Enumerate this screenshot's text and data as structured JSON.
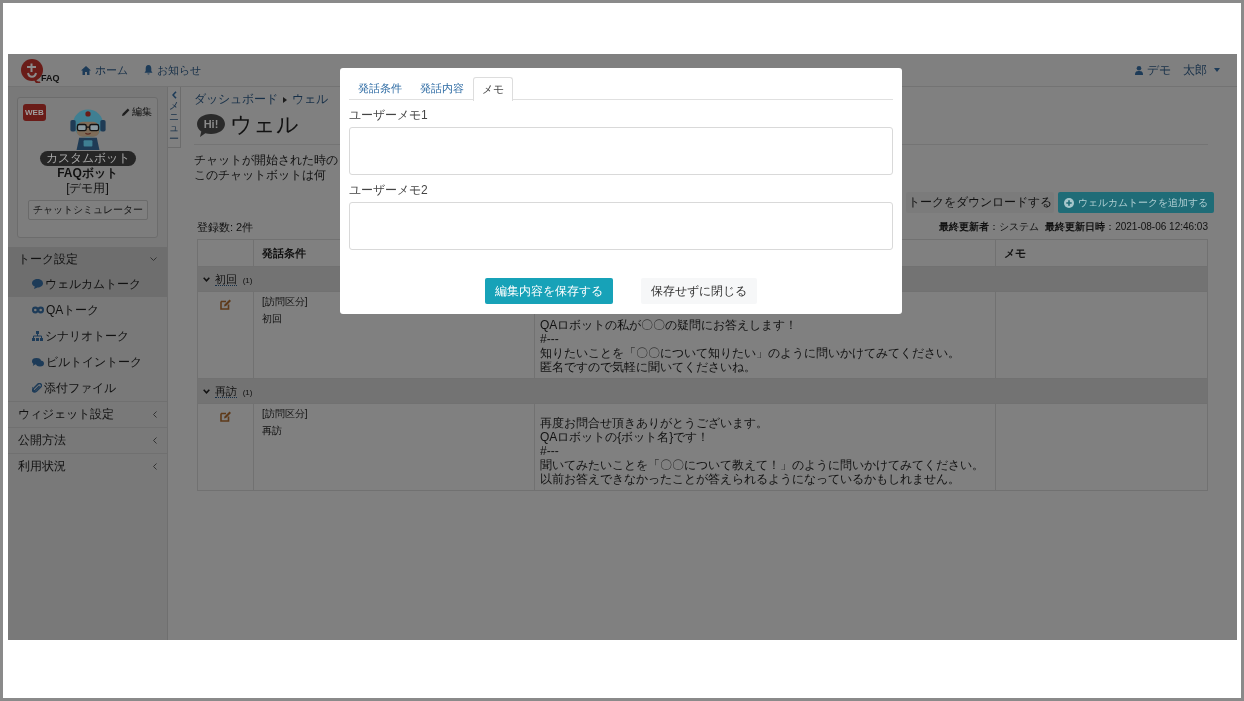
{
  "header": {
    "logo_text": "FAQ",
    "nav": [
      {
        "label": "ホーム"
      },
      {
        "label": "お知らせ"
      }
    ],
    "user": "デモ　太郎"
  },
  "sidebar": {
    "profile": {
      "web_badge": "WEB",
      "edit": "編集",
      "badge": "カスタムボット",
      "name": "FAQボット",
      "note": "[デモ用]",
      "simulator_button": "チャットシミュレーター"
    },
    "menu": [
      {
        "label": "トーク設定",
        "expanded": true,
        "children": [
          {
            "label": "ウェルカムトーク",
            "selected": true
          },
          {
            "label": "QAトーク",
            "selected": false
          },
          {
            "label": "シナリオトーク",
            "selected": false
          },
          {
            "label": "ビルトイントーク",
            "selected": false
          },
          {
            "label": "添付ファイル",
            "selected": false
          }
        ]
      },
      {
        "label": "ウィジェット設定",
        "expanded": false
      },
      {
        "label": "公開方法",
        "expanded": false
      },
      {
        "label": "利用状況",
        "expanded": false
      }
    ]
  },
  "main": {
    "menu_toggle": "メニュー",
    "breadcrumb": [
      "ダッシュボード",
      "ウェル"
    ],
    "title_icon": "Hi!",
    "title": "ウェル",
    "description": [
      "チャットが開始された時の",
      "このチャットボットは何"
    ],
    "actions": [
      {
        "label": "トークをダウンロードする",
        "kind": "secondary"
      },
      {
        "label": "ウェルカムトークを追加する",
        "kind": "primary"
      }
    ],
    "count": "登録数: 2件",
    "updated_by": "**最終更新者**：システム",
    "updated_at": "**最終更新日時**：2021-08-06 12:46:03",
    "table": {
      "header": {
        "condition": "発話条件",
        "memo": "メモ"
      },
      "groups": [
        {
          "label": "初回",
          "count": "(1)",
          "expanded": true,
          "rows": [
            {
              "condition_label": "[訪問区分]",
              "condition_value": "初回",
              "content": [
                "QAロボットの私が〇〇の疑問にお答えします！",
                "#---",
                "知りたいことを「〇〇について知りたい」のように問いかけてみてください。",
                "匿名ですので気軽に聞いてくださいね。"
              ]
            }
          ]
        },
        {
          "label": "再訪",
          "count": "(1)",
          "expanded": true,
          "rows": [
            {
              "condition_label": "[訪問区分]",
              "condition_value": "再訪",
              "content": [
                "再度お問合せ頂きありがとうございます。",
                "QAロボットの{ボット名}です！",
                "#---",
                "聞いてみたいことを「〇〇について教えて！」のように問いかけてみてください。",
                "以前お答えできなかったことが答えられるようになっているかもしれません。"
              ]
            }
          ]
        }
      ]
    }
  },
  "modal": {
    "tabs": [
      {
        "label": "発話条件",
        "selected": false
      },
      {
        "label": "発話内容",
        "selected": false
      },
      {
        "label": "メモ",
        "selected": true
      }
    ],
    "fields": [
      {
        "label": "ユーザーメモ1"
      },
      {
        "label": "ユーザーメモ2"
      }
    ],
    "buttons": [
      {
        "label": "編集内容を保存する",
        "kind": "primary"
      },
      {
        "label": "保存せずに閉じる",
        "kind": "secondary"
      }
    ]
  }
}
